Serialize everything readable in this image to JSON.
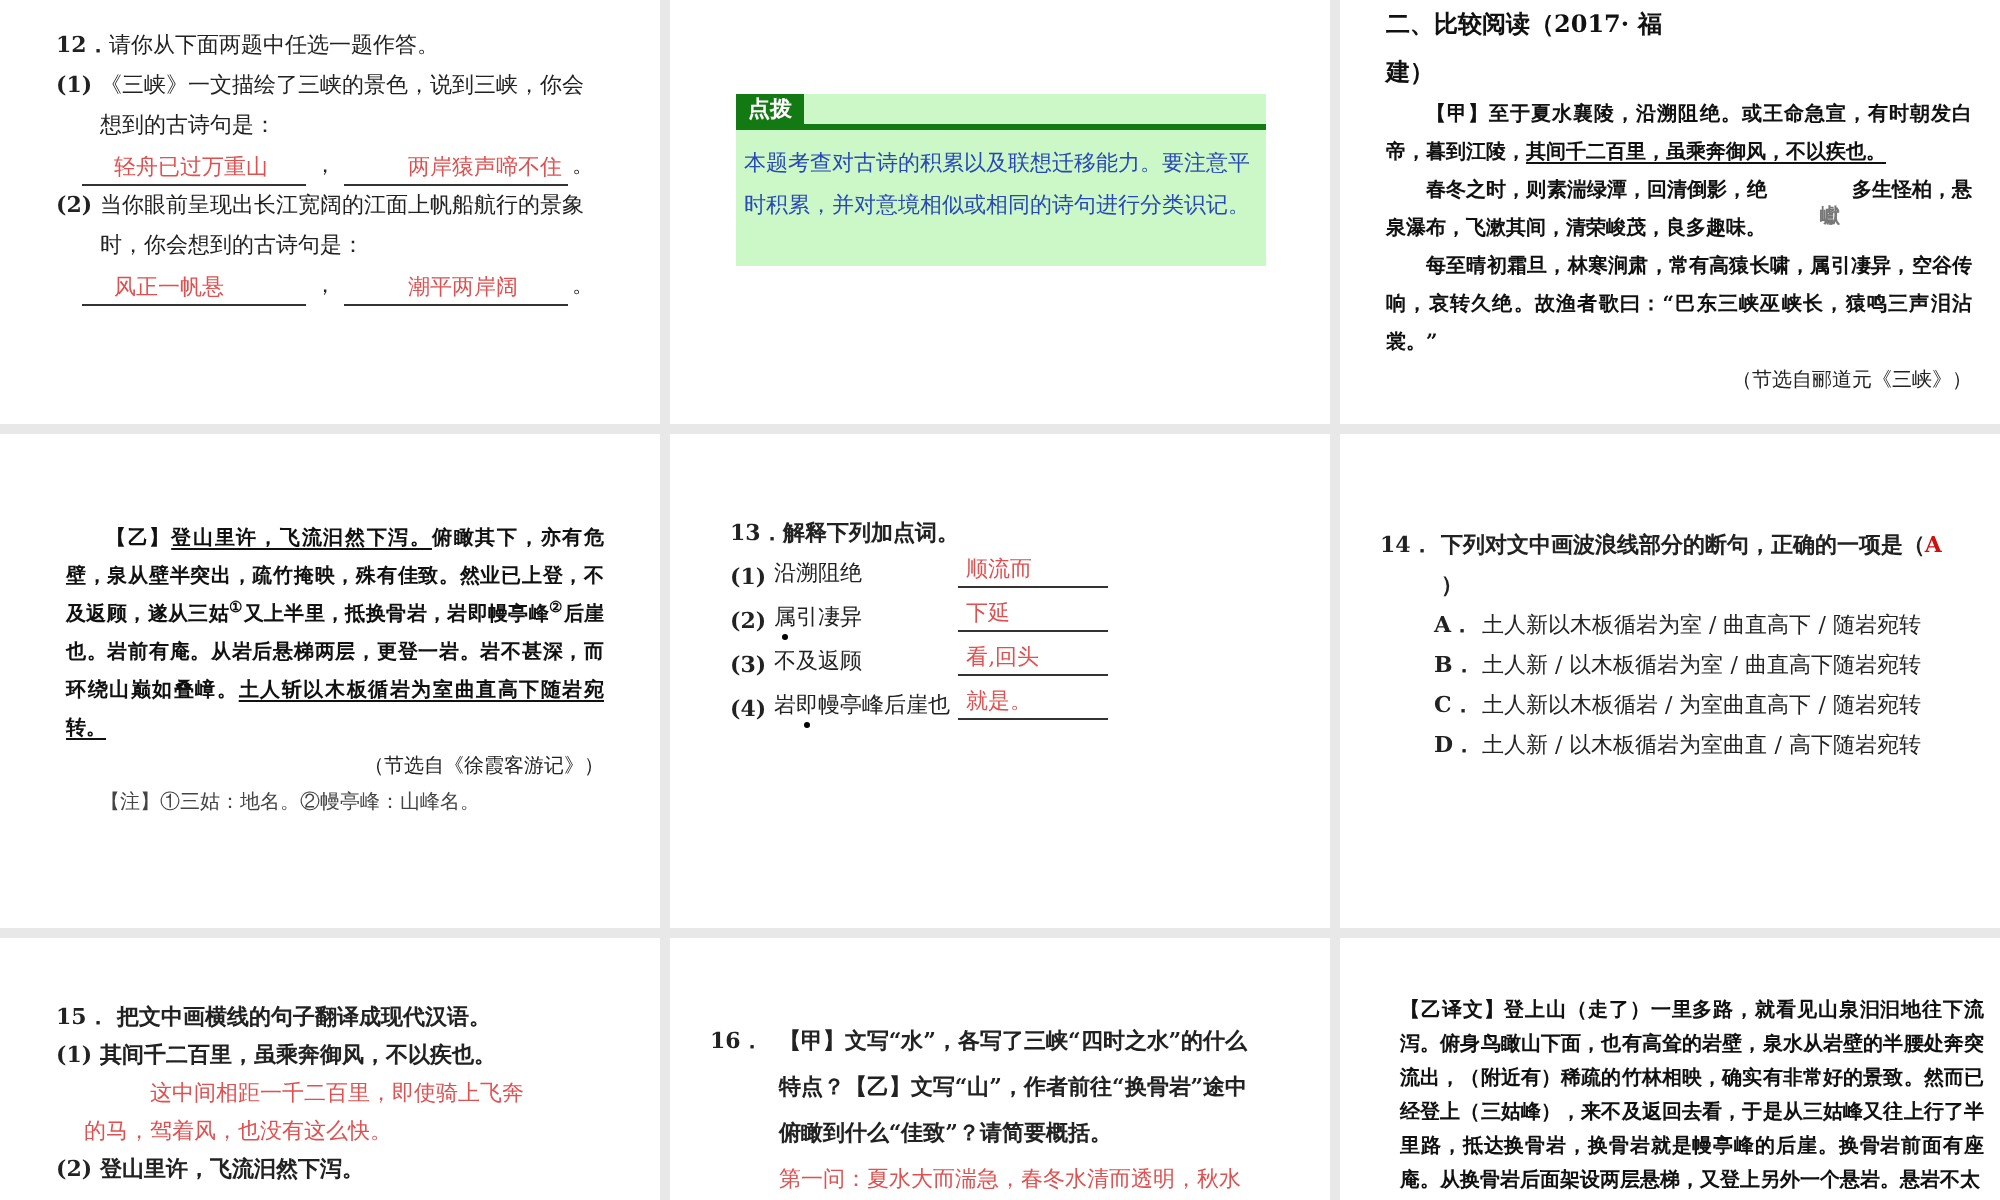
{
  "slides": [
    {
      "kind": "fill-in",
      "number": "12．",
      "prompt": "请你从下面两题中任选一题作答。",
      "items": [
        {
          "label": "(1)",
          "text": "《三峡》一文描绘了三峡的景色，说到三峡，你会想到的古诗句是：",
          "answers": [
            "轻舟已过万重山",
            "两岸猿声啼不住"
          ],
          "separator": "，",
          "end": "。"
        },
        {
          "label": "(2)",
          "text": "当你眼前呈现出长江宽阔的江面上帆船航行的景象时，你会想到的古诗句是：",
          "answers": [
            "风正一帆悬",
            "潮平两岸阔"
          ],
          "separator": "，",
          "end": "。"
        }
      ]
    },
    {
      "kind": "note",
      "tag": "点拨",
      "text": "本题考查对古诗的积累以及联想迁移能力。要注意平时积累，并对意境相似或相同的诗句进行分类识记。"
    },
    {
      "kind": "passage",
      "title": "二、比较阅读（2017· 福建）",
      "paragraphs": [
        [
          {
            "text": "【甲】至于夏水襄陵，沿溯阻绝。或王命急宣，有时朝发白帝，暮到江陵，",
            "kind": "plain"
          },
          {
            "text": "其间千二百里，虽乘奔御风，不以疾也。",
            "kind": "underline"
          }
        ],
        [
          {
            "text": "春冬之时，则素湍绿潭，回清倒影，绝",
            "kind": "plain"
          },
          {
            "text": "巘",
            "kind": "dropped"
          },
          {
            "text": "多生怪柏，悬泉瀑布，飞漱其间，清荣峻茂，良多趣味。",
            "kind": "plain"
          }
        ],
        [
          {
            "text": "每至晴初霜旦，林寒涧肃，常有高猿长啸，属引凄异，空谷传响，哀转久绝。故渔者歌曰：“巴东三峡巫峡长，猿鸣三声泪沾裳。”",
            "kind": "plain"
          }
        ]
      ],
      "source": "（节选自郦道元《三峡》）"
    },
    {
      "kind": "passage",
      "paragraphs": [
        [
          {
            "text": "【乙】",
            "kind": "plain"
          },
          {
            "text": "登山里许，飞流汩然下泻。",
            "kind": "underline"
          },
          {
            "text": "俯瞰其下，亦有危壁，泉从壁半突出，疏竹掩映，殊有佳致。然业已上登，不及返顾，遂从三姑$^{①}$又上半里，抵换骨岩，岩即幔亭峰$^{②}$后崖也。岩前有庵。从岩后悬梯两层，更登一岩。岩不甚深，而环绕山巅如叠嶂。",
            "kind": "plain"
          },
          {
            "text": "土人斩以木板循岩为室曲直高下随岩宛转。",
            "kind": "underline"
          }
        ]
      ],
      "source": "（节选自《徐霞客游记》）",
      "note": "【注】①三姑：地名。②幔亭峰：山峰名。"
    },
    {
      "kind": "terms",
      "number": "13．",
      "prompt": "解释下列加点词。",
      "items": [
        {
          "label": "(1)",
          "term": [
            {
              "text": "沿溯阻绝",
              "kind": "plain"
            }
          ],
          "answer": "顺流而"
        },
        {
          "label": "(2)",
          "term": [
            {
              "text": "属",
              "kind": "dotted"
            },
            {
              "text": "引凄异",
              "kind": "plain"
            }
          ],
          "answer": "下延"
        },
        {
          "label": "(3)",
          "term": [
            {
              "text": "不及返顾",
              "kind": "plain"
            }
          ],
          "answer": "看,回头"
        },
        {
          "label": "(4)",
          "term": [
            {
              "text": "岩",
              "kind": "plain"
            },
            {
              "text": "即",
              "kind": "dotted"
            },
            {
              "text": "幔亭峰后崖也",
              "kind": "plain"
            }
          ],
          "answer": "就是。"
        }
      ]
    },
    {
      "kind": "choice",
      "number": "14．",
      "prompt": "下列对文中画波浪线部分的断句，正确的一项是（",
      "answer": "A",
      "close": "）",
      "options": [
        {
          "letter": "A．",
          "text": "土人新以木板循岩为室 / 曲直高下 / 随岩宛转"
        },
        {
          "letter": "B．",
          "text": "土人新 / 以木板循岩为室 / 曲直高下随岩宛转"
        },
        {
          "letter": "C．",
          "text": "土人新以木板循岩 / 为室曲直高下 / 随岩宛转"
        },
        {
          "letter": "D．",
          "text": "土人新 / 以木板循岩为室曲直 / 高下随岩宛转"
        }
      ]
    },
    {
      "kind": "translate",
      "number": "15．",
      "prompt": "把文中画横线的句子翻译成现代汉语。",
      "items": [
        {
          "label": "(1)",
          "text": "其间千二百里，虽乘奔御风，不以疾也。",
          "answer": "这中间相距一千二百里，即使骑上飞奔的马，驾着风，也没有这么快。"
        },
        {
          "label": "(2)",
          "text": "登山里许，飞流汩然下泻。"
        }
      ]
    },
    {
      "kind": "question",
      "number": "16．",
      "prompt": "【甲】文写“水”，各写了三峡“四时之水”的什么特点？【乙】文写“山”，作者前往“换骨岩”途中俯瞰到什么“佳致”？请简要概括。",
      "answer": "第一问：夏水大而湍急，春冬水清而透明，秋水"
    },
    {
      "kind": "translation",
      "text": "【乙译文】登上山（走了）一里多路，就看见山泉汩汩地往下流泻。俯身鸟瞰山下面，也有高耸的岩壁，泉水从岩壁的半腰处奔突流出，（附近有）稀疏的竹林相映，确实有非常好的景致。然而已经登上（三姑峰），来不及返回去看，于是从三姑峰又往上行了半里路，抵达换骨岩，换骨岩就是幔亭峰的后崖。换骨岩前面有座庵。从换骨岩后面架设两层悬梯，又登上另外一个悬岩。悬岩不太"
    }
  ]
}
